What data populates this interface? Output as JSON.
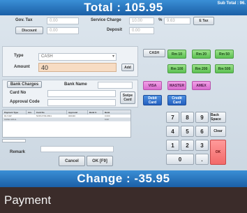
{
  "header": {
    "total_label": "Total : 105.95",
    "subtotal_label": "Sub Total : 96."
  },
  "fields": {
    "gov_tax_label": "Gov. Tax",
    "gov_tax_value": "0.00",
    "service_charge_label": "Service Charge",
    "service_charge_value": "10.00",
    "percent_sign": "%",
    "service_charge_amount": "9.63",
    "e_tax_label": "E Tax",
    "discount_label": "Discount",
    "discount_value": "0.00",
    "deposit_label": "Deposit",
    "deposit_value": "0.00"
  },
  "payment": {
    "type_label": "Type",
    "type_value": "CASH",
    "amount_label": "Amount",
    "amount_value": "40",
    "add_label": "Add",
    "bank_charges_label": "Bank Charges",
    "bank_name_label": "Bank Name",
    "card_no_label": "Card No",
    "approval_code_label": "Approval Code",
    "swipe_card_label": "Swipe Card",
    "remark_label": "Remark",
    "cancel_label": "Cancel",
    "ok_label": "OK [F9]"
  },
  "table": {
    "headers": [
      "Payment Type",
      "Am.",
      "Card No",
      "Approval",
      "Bank C.",
      "Bank"
    ],
    "rows": [
      [
        "RLYHW",
        "",
        "5235-6709-0841",
        "000430",
        "",
        "0.000"
      ],
      [
        "CASH CPLG",
        "",
        "",
        "",
        "",
        "0.00"
      ]
    ]
  },
  "quick_buttons": {
    "cash": "CASH",
    "green": [
      "Rm 10",
      "Rm 20",
      "Rm 50",
      "Rm 100",
      "Rm 200",
      "Rm 500"
    ],
    "pink": [
      "VISA",
      "MASTER",
      "AMEX"
    ],
    "blue": [
      "Debit Card",
      "Credit Card"
    ]
  },
  "keypad": {
    "keys": [
      "7",
      "8",
      "9",
      "4",
      "5",
      "6",
      "1",
      "2",
      "3",
      "0",
      "."
    ],
    "back_space": "Back Space",
    "clear": "Clear",
    "ok": "OK"
  },
  "change_label": "Change :  -35.95",
  "footer_title": "Payment"
}
